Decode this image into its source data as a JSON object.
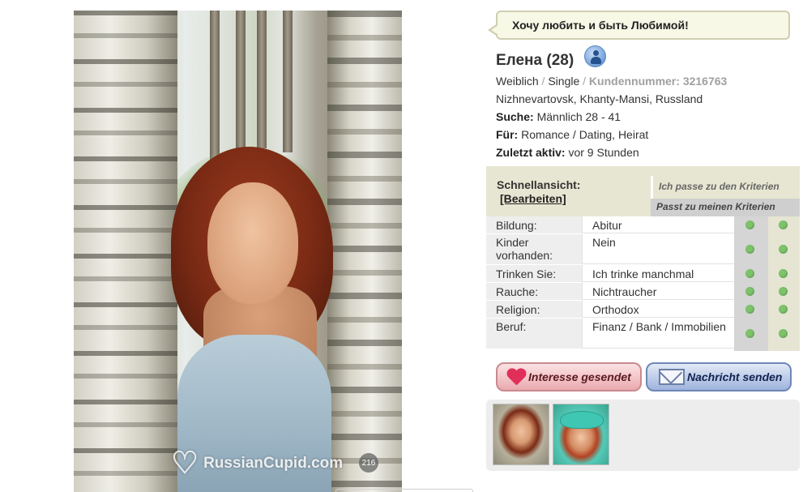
{
  "profile": {
    "quote": "Хочу любить и быть Любимой!",
    "name": "Елена (28)",
    "gender": "Weiblich",
    "sep1": "/",
    "status": "Single",
    "sep2": "/",
    "member_label": "Kundennummer:",
    "member_id": "3216763",
    "location": "Nizhnevartovsk, Khanty-Mansi, Russland",
    "search_label": "Suche:",
    "search_value": "Männlich 28 - 41",
    "for_label": "Für:",
    "for_value": "Romance / Dating, Heirat",
    "last_active_label": "Zuletzt aktiv:",
    "last_active_value": "vor 9 Stunden"
  },
  "photo": {
    "watermark": "RussianCupid.com",
    "count": "216"
  },
  "quickview": {
    "title": "Schnellansicht:",
    "edit_link": "[Bearbeiten]",
    "criteria_a": "Ich passe zu den Kriterien",
    "criteria_b": "Passt zu meinen Kriterien",
    "rows": [
      {
        "key": "Bildung:",
        "value": "Abitur",
        "match_a": true,
        "match_b": true
      },
      {
        "key": "Kinder vorhanden:",
        "value": "Nein",
        "match_a": true,
        "match_b": true
      },
      {
        "key": "Trinken Sie:",
        "value": "Ich trinke manchmal",
        "match_a": true,
        "match_b": true
      },
      {
        "key": "Rauche:",
        "value": "Nichtraucher",
        "match_a": true,
        "match_b": true
      },
      {
        "key": "Religion:",
        "value": "Orthodox",
        "match_a": true,
        "match_b": true
      },
      {
        "key": "Beruf:",
        "value": "Finanz / Bank / Immobilien",
        "match_a": true,
        "match_b": true
      }
    ],
    "match_color": "#7cc36a"
  },
  "actions": {
    "interest": "Interesse gesendet",
    "message": "Nachricht senden"
  }
}
